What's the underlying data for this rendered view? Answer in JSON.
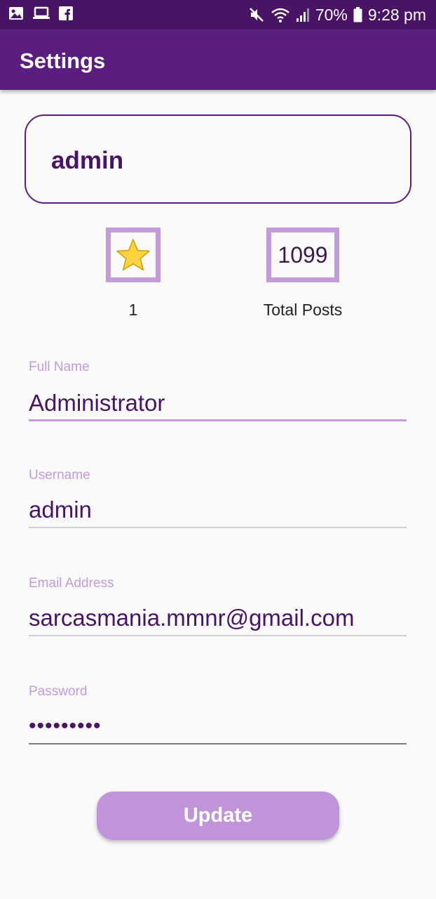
{
  "status_bar": {
    "left_icons": [
      "gallery-icon",
      "laptop-icon",
      "facebook-icon"
    ],
    "right_icons": [
      "mute-icon",
      "wifi-icon",
      "signal-icon",
      "battery-icon"
    ],
    "battery": "70%",
    "time": "9:28 pm"
  },
  "app_bar": {
    "title": "Settings"
  },
  "profile": {
    "name": "admin"
  },
  "stats": {
    "rating_icon": "star-icon",
    "rating_value": "1",
    "posts_count": "1099",
    "posts_label": "Total Posts"
  },
  "form": {
    "full_name": {
      "label": "Full Name",
      "value": "Administrator"
    },
    "username": {
      "label": "Username",
      "value": "admin"
    },
    "email": {
      "label": "Email Address",
      "value": "sarcasmania.mmnr@gmail.com"
    },
    "password": {
      "label": "Password",
      "value": "•••••••••"
    }
  },
  "update_button": {
    "label": "Update"
  },
  "colors": {
    "status_bar": "#4a1466",
    "app_bar": "#5b1e80",
    "accent": "#c39bdb",
    "text_primary": "#4a1466",
    "button": "#c194da"
  }
}
